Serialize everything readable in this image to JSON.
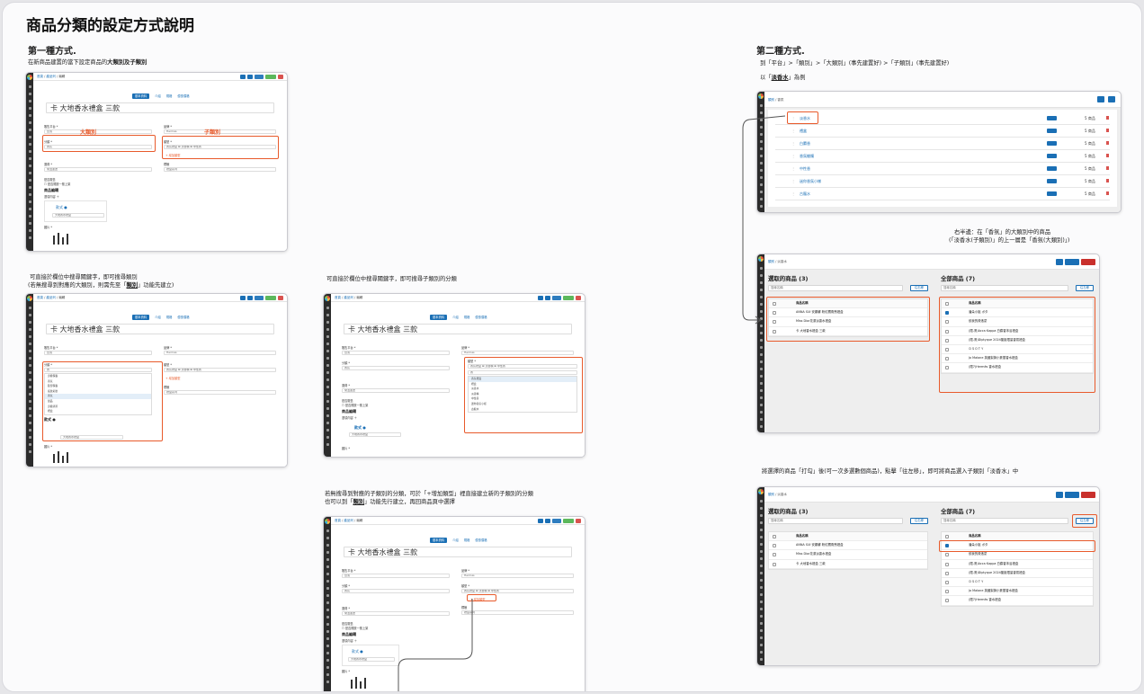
{
  "title": "商品分類的設定方式說明",
  "method1": {
    "heading": "第一種方式.",
    "intro_pre": "在新商品建置的當下設定商品的",
    "intro_bold": "大類別及子類別",
    "note_left_1": "可直接於欄位中搜尋關鍵字，即可搜尋類別",
    "note_left_2_pre": "(若無搜尋到對應的大類別，則需先至「",
    "note_left_2_link": "類別",
    "note_left_2_post": "」功能先建立)",
    "note_mid": "可直接於欄位中搜尋關鍵字，即可搜尋子類別的分類",
    "note_bottom_1": "若無搜尋到對應的子類別的分類，可於「+增加類型」裡直接建立新的子類別的分類",
    "note_bottom_2_pre": "也可以到「",
    "note_bottom_2_link": "類別",
    "note_bottom_2_post": "」功能先行建立，再回商品頁中選擇"
  },
  "method2": {
    "heading": "第二種方式.",
    "step1": "到「平台」>「類別」>「大類別」(事先建置好) >「子類別」(事先建置好)",
    "step2_pre": "以「",
    "step2_link": "淡香水",
    "step2_post": "」為例",
    "note_right_1": "右半邊：在「香氛」的大類別中的商品",
    "note_right_2": "(「淡香水(子類別)」的上一層是「香氛(大類別)」)",
    "note_bottom": "將選擇的商品「打勾」後(可一次多選數個商品)，點擊「往左移」，即可將商品選入子類別「淡香水」中"
  },
  "editor": {
    "crumb_home": "首頁",
    "crumb_mid": "產品列",
    "crumb_cur": "編輯",
    "tabs": [
      "基本資料",
      "介紹",
      "規格",
      "優惠價格"
    ],
    "product_name": "卡 大地香水禮盒 三款",
    "label_platform": "販售平台 *",
    "value_platform": "台灣",
    "label_brand": "品牌 *",
    "value_brand": "Hermès",
    "label_category": "分類 *",
    "value_category": "香氛",
    "label_subcategory": "類型 *",
    "sub_tags": [
      "香氛禮盒",
      "淡香精",
      "中性香"
    ],
    "add_type": "+ 增加類型",
    "label_ship": "運費 *",
    "value_ship": "常溫運送",
    "label_tag": "標籤",
    "value_tag": "禮盒系列",
    "label_sale": "是否販售",
    "check_sale": "是否開放一般上架",
    "section_edit": "商品編輯",
    "label_options": "選項內容",
    "option_title": "款式",
    "option_value": "大地香水禮盒",
    "image_label": "圖片 *",
    "tag_main": "大類別",
    "tag_sub": "子類別",
    "search_text": "香",
    "dd_main": [
      "身體保養",
      "香氛",
      "臉部保養",
      "底妝彩妝",
      "香氛",
      "髮品",
      "身體清潔",
      "禮盒"
    ],
    "dd_sub": [
      "香氛禮盒",
      "禮盒",
      "淡香水",
      "淡香精",
      "中性香",
      "迷你香氛小樣",
      "古龍水"
    ],
    "save": "儲存"
  },
  "category_list": {
    "crumb_home": "類別",
    "crumb_cur": "香氛",
    "rows": [
      {
        "name": "淡香水",
        "count": "5 商品"
      },
      {
        "name": "禮盒",
        "count": "5 商品"
      },
      {
        "name": "白麝香",
        "count": "5 商品"
      },
      {
        "name": "香氛蠟燭",
        "count": "5 商品"
      },
      {
        "name": "中性香",
        "count": "5 商品"
      },
      {
        "name": "迷你香氛小樣",
        "count": "5 商品"
      },
      {
        "name": "古龍水",
        "count": "5 商品"
      }
    ]
  },
  "selector": {
    "crumb_home": "類別",
    "crumb_cur": "淡香水",
    "left_title": "選取的商品 (3)",
    "right_title": "全部商品 (7)",
    "search_placeholder": "搜尋名稱",
    "btn_right": "往右移",
    "btn_left": "往左移",
    "col_name": "商品名稱",
    "left_items": [
      "ANNA SUI 安娜蘇 粉紅獨角獸禮盒",
      "Miss Dior花漾淡香水禮盒",
      "卡 大地香水禮盒 三款"
    ],
    "right_items": [
      "潘朵小姐 ボタ",
      "依我的費洛蒙",
      "(限-清)Acca Kappa 白麝香沐浴禮盒",
      "(限-清)Diptyque 2024聖誕限量香氛禮盒",
      "ＤＳＯＴＹ",
      "Jo Malone 英國梨與小蒼蘭香水禮盒",
      "(限7)Hermès 香水禮盒"
    ]
  },
  "colors": {
    "accent": "#e85a2b",
    "link": "#1a6fb5",
    "sidebar": "#2b2b2b"
  }
}
